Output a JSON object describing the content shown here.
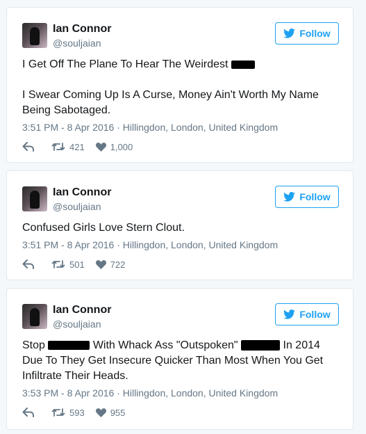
{
  "tweets": [
    {
      "name": "Ian Connor",
      "handle": "@souljaian",
      "follow_label": "Follow",
      "line1": "I Get Off The Plane To Hear The Weirdest",
      "line2": "I Swear Coming Up Is A Curse, Money Ain't Worth My Name Being Sabotaged.",
      "timestamp": "3:51 PM - 8 Apr 2016 · Hillingdon, London, United Kingdom",
      "retweets": "421",
      "likes": "1,000"
    },
    {
      "name": "Ian Connor",
      "handle": "@souljaian",
      "follow_label": "Follow",
      "line1": "Confused Girls Love Stern Clout.",
      "timestamp": "3:51 PM - 8 Apr 2016 · Hillingdon, London, United Kingdom",
      "retweets": "501",
      "likes": "722"
    },
    {
      "name": "Ian Connor",
      "handle": "@souljaian",
      "follow_label": "Follow",
      "part1": "Stop",
      "part2": "With Whack Ass \"Outspoken\"",
      "part3": "In 2014 Due To They Get Insecure Quicker Than Most When You Get Infiltrate Their Heads.",
      "timestamp": "3:53 PM - 8 Apr 2016 · Hillingdon, London, United Kingdom",
      "retweets": "593",
      "likes": "955"
    }
  ],
  "colors": {
    "accent": "#1da1f2",
    "muted": "#657786",
    "text": "#14171a",
    "border": "#e1e8ed",
    "background": "#f5f8fa"
  },
  "icons": [
    "bird-icon",
    "reply-icon",
    "retweet-icon",
    "heart-icon"
  ]
}
